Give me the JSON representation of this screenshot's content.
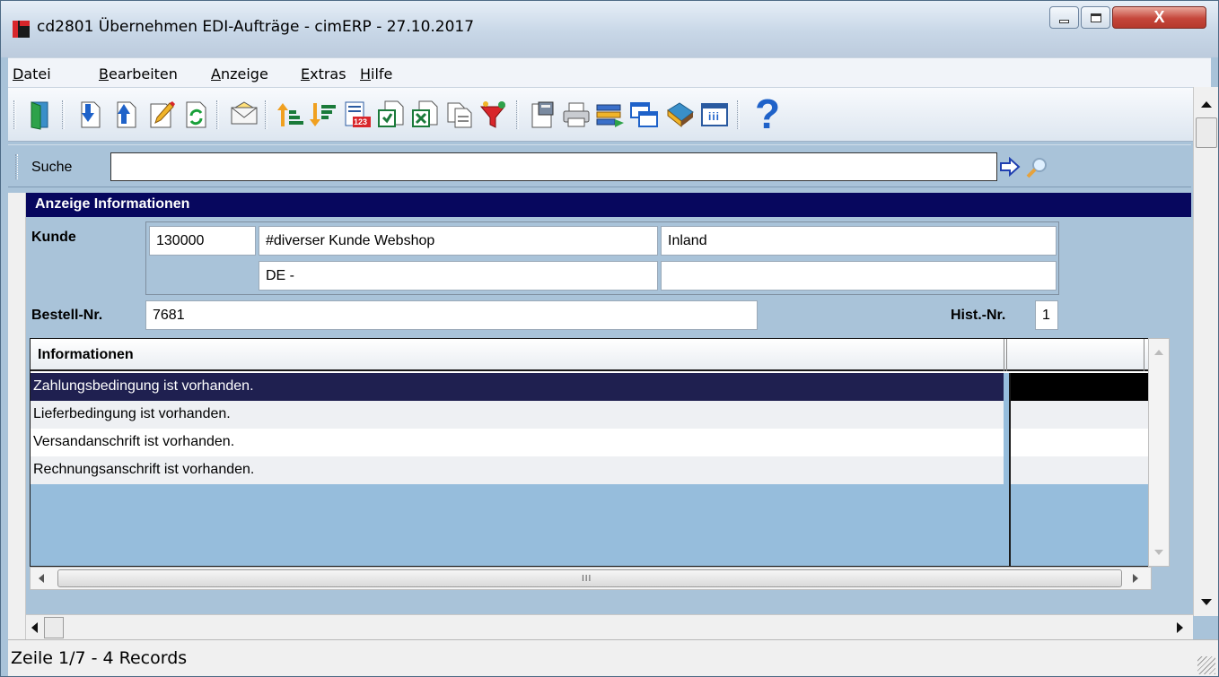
{
  "window": {
    "title": "cd2801 Übernehmen EDI-Aufträge - cimERP - 27.10.2017",
    "close_label": "X"
  },
  "menu": [
    {
      "mnemonic": "D",
      "rest": "atei"
    },
    {
      "mnemonic": "B",
      "rest": "earbeiten"
    },
    {
      "mnemonic": "A",
      "rest": "nzeige"
    },
    {
      "mnemonic": "E",
      "rest": "xtras"
    },
    {
      "mnemonic": "H",
      "rest": "ilfe"
    }
  ],
  "toolbar": {
    "icons": [
      "exit-door-icon",
      "download-icon",
      "upload-icon",
      "edit-pencil-icon",
      "refresh-icon",
      "mail-envelope-icon",
      "sort-ascending-icon",
      "sort-descending-icon",
      "number-list-icon",
      "export-document-icon",
      "excel-export-icon",
      "copy-document-icon",
      "filter-funnel-icon",
      "properties-icon",
      "printer-icon",
      "transfer-list-icon",
      "windows-icon",
      "book-tag-icon",
      "calendar-grid-icon",
      "help-question-icon"
    ],
    "help_glyph": "?",
    "calendar_glyph": "iii",
    "number_glyph": "123"
  },
  "search": {
    "label": "Suche",
    "value": ""
  },
  "section": {
    "title": "Anzeige Informationen"
  },
  "customer": {
    "label": "Kunde",
    "number": "130000",
    "name": "#diverser Kunde Webshop",
    "region": "Inland",
    "country": "DE -",
    "extra": ""
  },
  "order": {
    "label": "Bestell-Nr.",
    "value": "7681",
    "hist_label": "Hist.-Nr.",
    "hist_value": "1"
  },
  "grid": {
    "column_header": "Informationen",
    "column2_header": "",
    "rows": [
      {
        "text": "Zahlungsbedingung ist vorhanden."
      },
      {
        "text": "Lieferbedingung ist vorhanden."
      },
      {
        "text": "Versandanschrift ist vorhanden."
      },
      {
        "text": "Rechnungsanschrift ist vorhanden."
      }
    ],
    "hscroll_grip": "III"
  },
  "status": {
    "text": "Zeile 1/7 - 4 Records"
  },
  "colors": {
    "section_header": "#07075e",
    "selected_row": "#1f2050",
    "panel": "#a9c3d9",
    "grid_empty": "#96bddc"
  }
}
